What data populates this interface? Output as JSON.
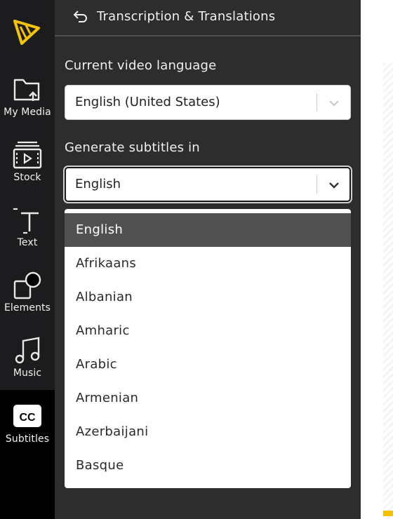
{
  "nav": {
    "items": [
      {
        "label": "My Media",
        "icon": "folder-upload-icon"
      },
      {
        "label": "Stock",
        "icon": "film-stock-icon"
      },
      {
        "label": "Text",
        "icon": "text-icon"
      },
      {
        "label": "Elements",
        "icon": "shapes-icon"
      },
      {
        "label": "Music",
        "icon": "music-note-icon"
      },
      {
        "label": "Subtitles",
        "icon": "cc-icon"
      }
    ],
    "active": "Subtitles"
  },
  "header": {
    "title": "Transcription & Translations"
  },
  "video_language": {
    "label": "Current video language",
    "value": "English (United States)"
  },
  "subtitle_language": {
    "label": "Generate subtitles in",
    "value": "English",
    "options": [
      "English",
      "Afrikaans",
      "Albanian",
      "Amharic",
      "Arabic",
      "Armenian",
      "Azerbaijani",
      "Basque"
    ],
    "selected": "English"
  },
  "colors": {
    "rail": "#1c1c1e",
    "panel": "#2d2d2d",
    "logo": "#f5c400",
    "menu_selected": "#515151"
  }
}
